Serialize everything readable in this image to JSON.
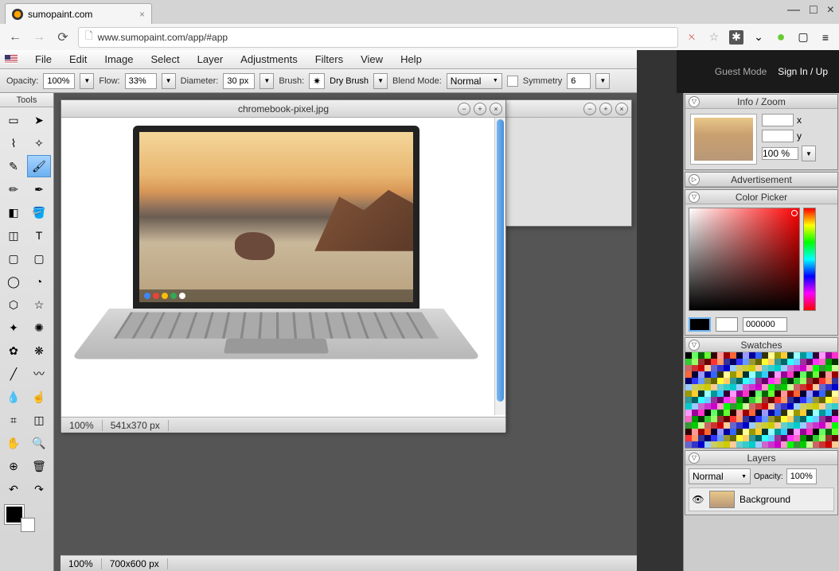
{
  "browser": {
    "tab_title": "sumopaint.com",
    "url": "www.sumopaint.com/app/#app"
  },
  "menu": {
    "items": [
      "File",
      "Edit",
      "Image",
      "Select",
      "Layer",
      "Adjustments",
      "Filters",
      "View",
      "Help"
    ]
  },
  "options": {
    "opacity_label": "Opacity:",
    "opacity_value": "100%",
    "flow_label": "Flow:",
    "flow_value": "33%",
    "diameter_label": "Diameter:",
    "diameter_value": "30 px",
    "brush_label": "Brush:",
    "brush_value": "Dry Brush",
    "blend_label": "Blend Mode:",
    "blend_value": "Normal",
    "symmetry_label": "Symmetry",
    "symmetry_value": "6"
  },
  "toolbox": {
    "title": "Tools"
  },
  "doc1": {
    "title": "chromebook-pixel.jpg",
    "zoom": "100%",
    "dims": "541x370 px"
  },
  "doc2": {
    "zoom": "100%",
    "dims": "700x600 px"
  },
  "header": {
    "guest": "Guest Mode",
    "signin": "Sign In / Up"
  },
  "panels": {
    "info": {
      "title": "Info / Zoom",
      "x": "x",
      "y": "y",
      "zoom": "100 %"
    },
    "ad": {
      "title": "Advertisement"
    },
    "picker": {
      "title": "Color Picker",
      "hex": "000000"
    },
    "swatches": {
      "title": "Swatches"
    },
    "layers": {
      "title": "Layers",
      "blend": "Normal",
      "opacity_label": "Opacity:",
      "opacity_value": "100%",
      "bg": "Background"
    }
  }
}
